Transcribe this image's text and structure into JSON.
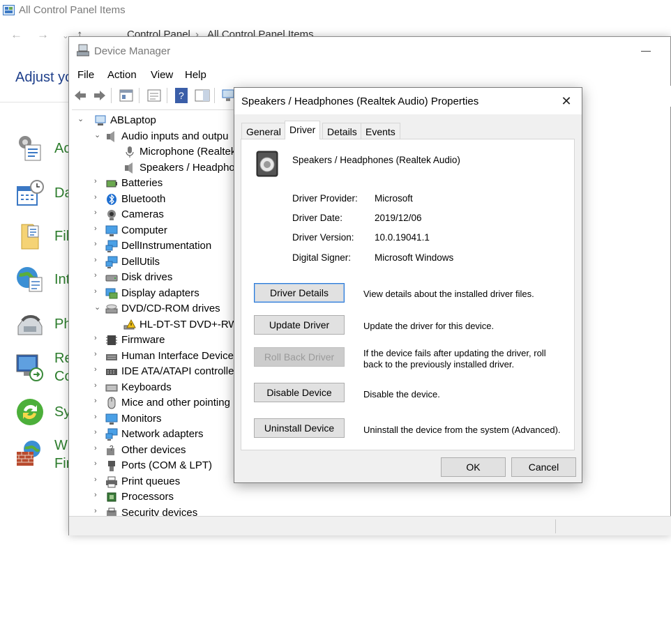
{
  "control_panel": {
    "title": "All Control Panel Items",
    "breadcrumb": [
      "Control Panel",
      "All Control Panel Items"
    ],
    "heading": "Adjust yo",
    "items": [
      {
        "label": "Ac",
        "icon": "action-center-icon"
      },
      {
        "label": "Da",
        "icon": "date-time-icon"
      },
      {
        "label": "Fil",
        "icon": "file-explorer-options-icon"
      },
      {
        "label": "Int",
        "icon": "internet-options-icon"
      },
      {
        "label": "Ph",
        "icon": "phone-modem-icon"
      },
      {
        "label": "Re",
        "label2": "Co",
        "icon": "remoteapp-icon"
      },
      {
        "label": "Sy",
        "icon": "sync-center-icon"
      },
      {
        "label": "Wi",
        "label2": "Fir",
        "icon": "firewall-icon"
      }
    ]
  },
  "device_manager": {
    "title": "Device Manager",
    "menu": [
      "File",
      "Action",
      "View",
      "Help"
    ],
    "tree": {
      "root": "ABLaptop",
      "nodes": [
        {
          "label": "Audio inputs and outpu",
          "expanded": true,
          "icon": "speaker-icon"
        },
        {
          "label": "Microphone (Realtek",
          "child": true,
          "icon": "microphone-icon"
        },
        {
          "label": "Speakers / Headpho",
          "child": true,
          "icon": "speaker-icon"
        },
        {
          "label": "Batteries",
          "icon": "battery-icon"
        },
        {
          "label": "Bluetooth",
          "icon": "bluetooth-icon"
        },
        {
          "label": "Cameras",
          "icon": "camera-icon"
        },
        {
          "label": "Computer",
          "icon": "monitor-icon"
        },
        {
          "label": "DellInstrumentation",
          "icon": "network-icon"
        },
        {
          "label": "DellUtils",
          "icon": "network-icon"
        },
        {
          "label": "Disk drives",
          "icon": "disk-icon"
        },
        {
          "label": "Display adapters",
          "icon": "display-adapter-icon"
        },
        {
          "label": "DVD/CD-ROM drives",
          "expanded": true,
          "icon": "dvd-icon"
        },
        {
          "label": "HL-DT-ST DVD+-RW",
          "child": true,
          "icon": "warning-dvd-icon"
        },
        {
          "label": "Firmware",
          "icon": "firmware-icon"
        },
        {
          "label": "Human Interface Devices",
          "icon": "hid-icon"
        },
        {
          "label": "IDE ATA/ATAPI controllers",
          "icon": "ide-icon"
        },
        {
          "label": "Keyboards",
          "icon": "keyboard-icon"
        },
        {
          "label": "Mice and other pointing",
          "icon": "mouse-icon"
        },
        {
          "label": "Monitors",
          "icon": "monitor-icon"
        },
        {
          "label": "Network adapters",
          "icon": "network-icon"
        },
        {
          "label": "Other devices",
          "icon": "other-device-icon"
        },
        {
          "label": "Ports (COM & LPT)",
          "icon": "port-icon"
        },
        {
          "label": "Print queues",
          "icon": "printer-icon"
        },
        {
          "label": "Processors",
          "icon": "processor-icon"
        },
        {
          "label": "Security devices",
          "icon": "security-icon"
        }
      ]
    }
  },
  "dialog": {
    "title": "Speakers / Headphones (Realtek Audio) Properties",
    "tabs": [
      "General",
      "Driver",
      "Details",
      "Events"
    ],
    "active_tab": "Driver",
    "device_name": "Speakers / Headphones (Realtek Audio)",
    "info": [
      {
        "label": "Driver Provider:",
        "value": "Microsoft"
      },
      {
        "label": "Driver Date:",
        "value": "2019/12/06"
      },
      {
        "label": "Driver Version:",
        "value": "10.0.19041.1"
      },
      {
        "label": "Digital Signer:",
        "value": "Microsoft Windows"
      }
    ],
    "actions": [
      {
        "button": "Driver Details",
        "desc": "View details about the installed driver files."
      },
      {
        "button": "Update Driver",
        "desc": "Update the driver for this device."
      },
      {
        "button": "Roll Back Driver",
        "desc": "If the device fails after updating the driver, roll back to the previously installed driver."
      },
      {
        "button": "Disable Device",
        "desc": "Disable the device."
      },
      {
        "button": "Uninstall Device",
        "desc": "Uninstall the device from the system (Advanced)."
      }
    ],
    "ok": "OK",
    "cancel": "Cancel"
  }
}
